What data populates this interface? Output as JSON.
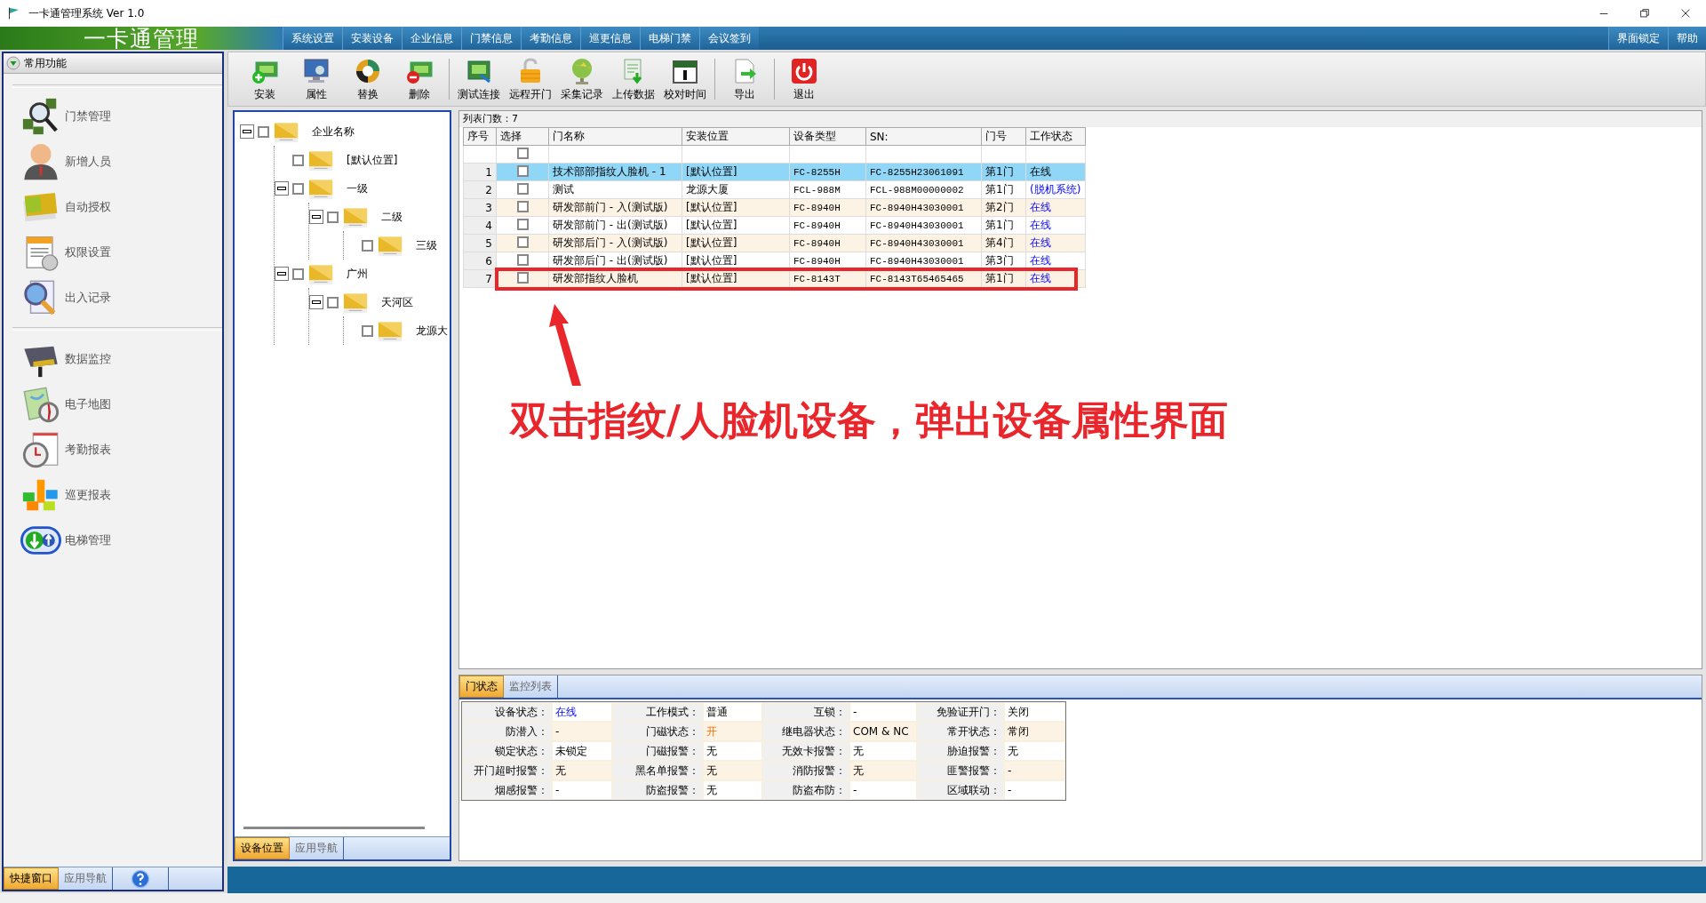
{
  "window": {
    "title": "一卡通管理系统 Ver 1.0"
  },
  "header": {
    "logo": "一卡通管理",
    "menu": [
      "系统设置",
      "安装设备",
      "企业信息",
      "门禁信息",
      "考勤信息",
      "巡更信息",
      "电梯门禁",
      "会议签到"
    ],
    "right_menu": [
      "界面锁定",
      "帮助"
    ]
  },
  "sidebar": {
    "title": "常用功能",
    "groups": [
      [
        "门禁管理",
        "新增人员",
        "自动授权",
        "权限设置",
        "出入记录"
      ],
      [
        "数据监控",
        "电子地图",
        "考勤报表",
        "巡更报表",
        "电梯管理"
      ]
    ],
    "tabs": [
      {
        "label": "快捷窗口",
        "selected": true
      },
      {
        "label": "应用导航",
        "selected": false
      }
    ]
  },
  "toolbar": {
    "groups": [
      [
        "安装",
        "属性",
        "替换",
        "删除"
      ],
      [
        "测试连接",
        "远程开门",
        "采集记录",
        "上传数据",
        "校对时间"
      ],
      [
        "导出"
      ],
      [
        "退出"
      ]
    ]
  },
  "tree": {
    "items": [
      {
        "label": "企业名称",
        "checked": false,
        "expanded": true,
        "children": [
          {
            "label": "[默认位置]",
            "checked": false
          },
          {
            "label": "一级",
            "checked": false,
            "expanded": true,
            "children": [
              {
                "label": "二级",
                "checked": false,
                "expanded": true,
                "children": [
                  {
                    "label": "三级",
                    "checked": false
                  }
                ]
              }
            ]
          },
          {
            "label": "广州",
            "checked": false,
            "expanded": true,
            "children": [
              {
                "label": "天河区",
                "checked": false,
                "expanded": true,
                "children": [
                  {
                    "label": "龙源大",
                    "checked": false
                  }
                ]
              }
            ]
          }
        ]
      }
    ],
    "tabs": [
      {
        "label": "设备位置",
        "selected": true
      },
      {
        "label": "应用导航",
        "selected": false
      }
    ]
  },
  "device_table": {
    "count_label": "列表门数：7",
    "columns": [
      "序号",
      "选择",
      "门名称",
      "安装位置",
      "设备类型",
      "SN:",
      "门号",
      "工作状态"
    ],
    "select_all_checked": false,
    "rows": [
      {
        "index": "1",
        "checked": false,
        "selected": true,
        "name": "技术部部指纹人脸机 - 1",
        "location": "[默认位置]",
        "device_type": "FC-8255H",
        "sn": "FC-8255H23061091",
        "door": "第1门",
        "status": "在线"
      },
      {
        "index": "2",
        "checked": false,
        "selected": false,
        "name": "测试",
        "location": "龙源大厦",
        "device_type": "FCL-988M",
        "sn": "FCL-988M00000002",
        "door": "第1门",
        "status": "(脱机系统)"
      },
      {
        "index": "3",
        "checked": false,
        "selected": false,
        "name": "研发部前门 - 入(测试版)",
        "location": "[默认位置]",
        "device_type": "FC-8940H",
        "sn": "FC-8940H43030001",
        "door": "第2门",
        "status": "在线"
      },
      {
        "index": "4",
        "checked": false,
        "selected": false,
        "name": "研发部前门 - 出(测试版)",
        "location": "[默认位置]",
        "device_type": "FC-8940H",
        "sn": "FC-8940H43030001",
        "door": "第1门",
        "status": "在线"
      },
      {
        "index": "5",
        "checked": false,
        "selected": false,
        "name": "研发部后门 - 入(测试版)",
        "location": "[默认位置]",
        "device_type": "FC-8940H",
        "sn": "FC-8940H43030001",
        "door": "第4门",
        "status": "在线"
      },
      {
        "index": "6",
        "checked": false,
        "selected": false,
        "name": "研发部后门 - 出(测试版)",
        "location": "[默认位置]",
        "device_type": "FC-8940H",
        "sn": "FC-8940H43030001",
        "door": "第3门",
        "status": "在线"
      },
      {
        "index": "7",
        "checked": false,
        "selected": false,
        "name": "研发部指纹人脸机",
        "location": "[默认位置]",
        "device_type": "FC-8143T",
        "sn": "FC-8143T65465465",
        "door": "第1门",
        "status": "在线"
      }
    ]
  },
  "status_panel": {
    "tabs": [
      {
        "label": "门状态",
        "selected": true
      },
      {
        "label": "监控列表",
        "selected": false
      }
    ],
    "fields": [
      {
        "label": "设备状态：",
        "value": "在线",
        "kind": "online"
      },
      {
        "label": "工作模式：",
        "value": "普通",
        "kind": "plain"
      },
      {
        "label": "互锁：",
        "value": "-",
        "kind": "plain"
      },
      {
        "label": "免验证开门：",
        "value": "关闭",
        "kind": "plain"
      },
      {
        "label": "防潜入：",
        "value": "-",
        "kind": "plain"
      },
      {
        "label": "门磁状态：",
        "value": "开",
        "kind": "warning"
      },
      {
        "label": "继电器状态：",
        "value": "COM & NC",
        "kind": "plain"
      },
      {
        "label": "常开状态：",
        "value": "常闭",
        "kind": "plain"
      },
      {
        "label": "锁定状态：",
        "value": "未锁定",
        "kind": "plain"
      },
      {
        "label": "门磁报警：",
        "value": "无",
        "kind": "plain"
      },
      {
        "label": "无效卡报警：",
        "value": "无",
        "kind": "plain"
      },
      {
        "label": "胁迫报警：",
        "value": "无",
        "kind": "plain"
      },
      {
        "label": "开门超时报警：",
        "value": "无",
        "kind": "plain"
      },
      {
        "label": "黑名单报警：",
        "value": "无",
        "kind": "plain"
      },
      {
        "label": "消防报警：",
        "value": "无",
        "kind": "plain"
      },
      {
        "label": "匪警报警：",
        "value": "-",
        "kind": "plain"
      },
      {
        "label": "烟感报警：",
        "value": "-",
        "kind": "plain"
      },
      {
        "label": "防盗报警：",
        "value": "无",
        "kind": "plain"
      },
      {
        "label": "防盗布防：",
        "value": "-",
        "kind": "plain"
      },
      {
        "label": "区域联动：",
        "value": "-",
        "kind": "plain"
      }
    ]
  },
  "annotation": {
    "text": "双击指纹/人脸机设备，弹出设备属性界面"
  }
}
